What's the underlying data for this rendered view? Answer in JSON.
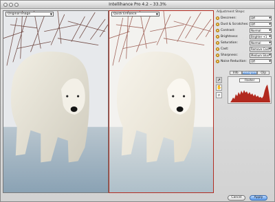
{
  "window": {
    "title": "Intellihance Pro 4.2 – 33.3%"
  },
  "panes": {
    "original": {
      "label": "Original Image"
    },
    "adjusted": {
      "label": "Quick Enhance"
    }
  },
  "panel": {
    "heading": "Adjustment Steps:",
    "rows": [
      {
        "label": "Descreen:",
        "value": "Off"
      },
      {
        "label": "Dust & Scratches:",
        "value": "Off"
      },
      {
        "label": "Contrast:",
        "value": "Normal"
      },
      {
        "label": "Brightness:",
        "value": "Brighter +1"
      },
      {
        "label": "Saturation:",
        "value": "Normal"
      },
      {
        "label": "Cast:",
        "value": "Remove Cast"
      },
      {
        "label": "Sharpness:",
        "value": "Medium Shar"
      },
      {
        "label": "Noise Reduction:",
        "value": "Off"
      }
    ]
  },
  "tabs": [
    {
      "label": "Info",
      "active": false
    },
    {
      "label": "Histogram",
      "active": true
    },
    {
      "label": "Clip",
      "active": false
    }
  ],
  "histogram": {
    "mode": "Flasher"
  },
  "buttons": {
    "cancel": "Cancel",
    "apply": "Apply"
  },
  "icons": [
    "arrow-tool-icon",
    "hand-tool-icon",
    "zoom-tool-icon",
    "adjustment-step-icon",
    "dropdown-arrow-icon"
  ],
  "colors": {
    "accent": "#b22a1f",
    "primary_button": "#5b97e5"
  }
}
